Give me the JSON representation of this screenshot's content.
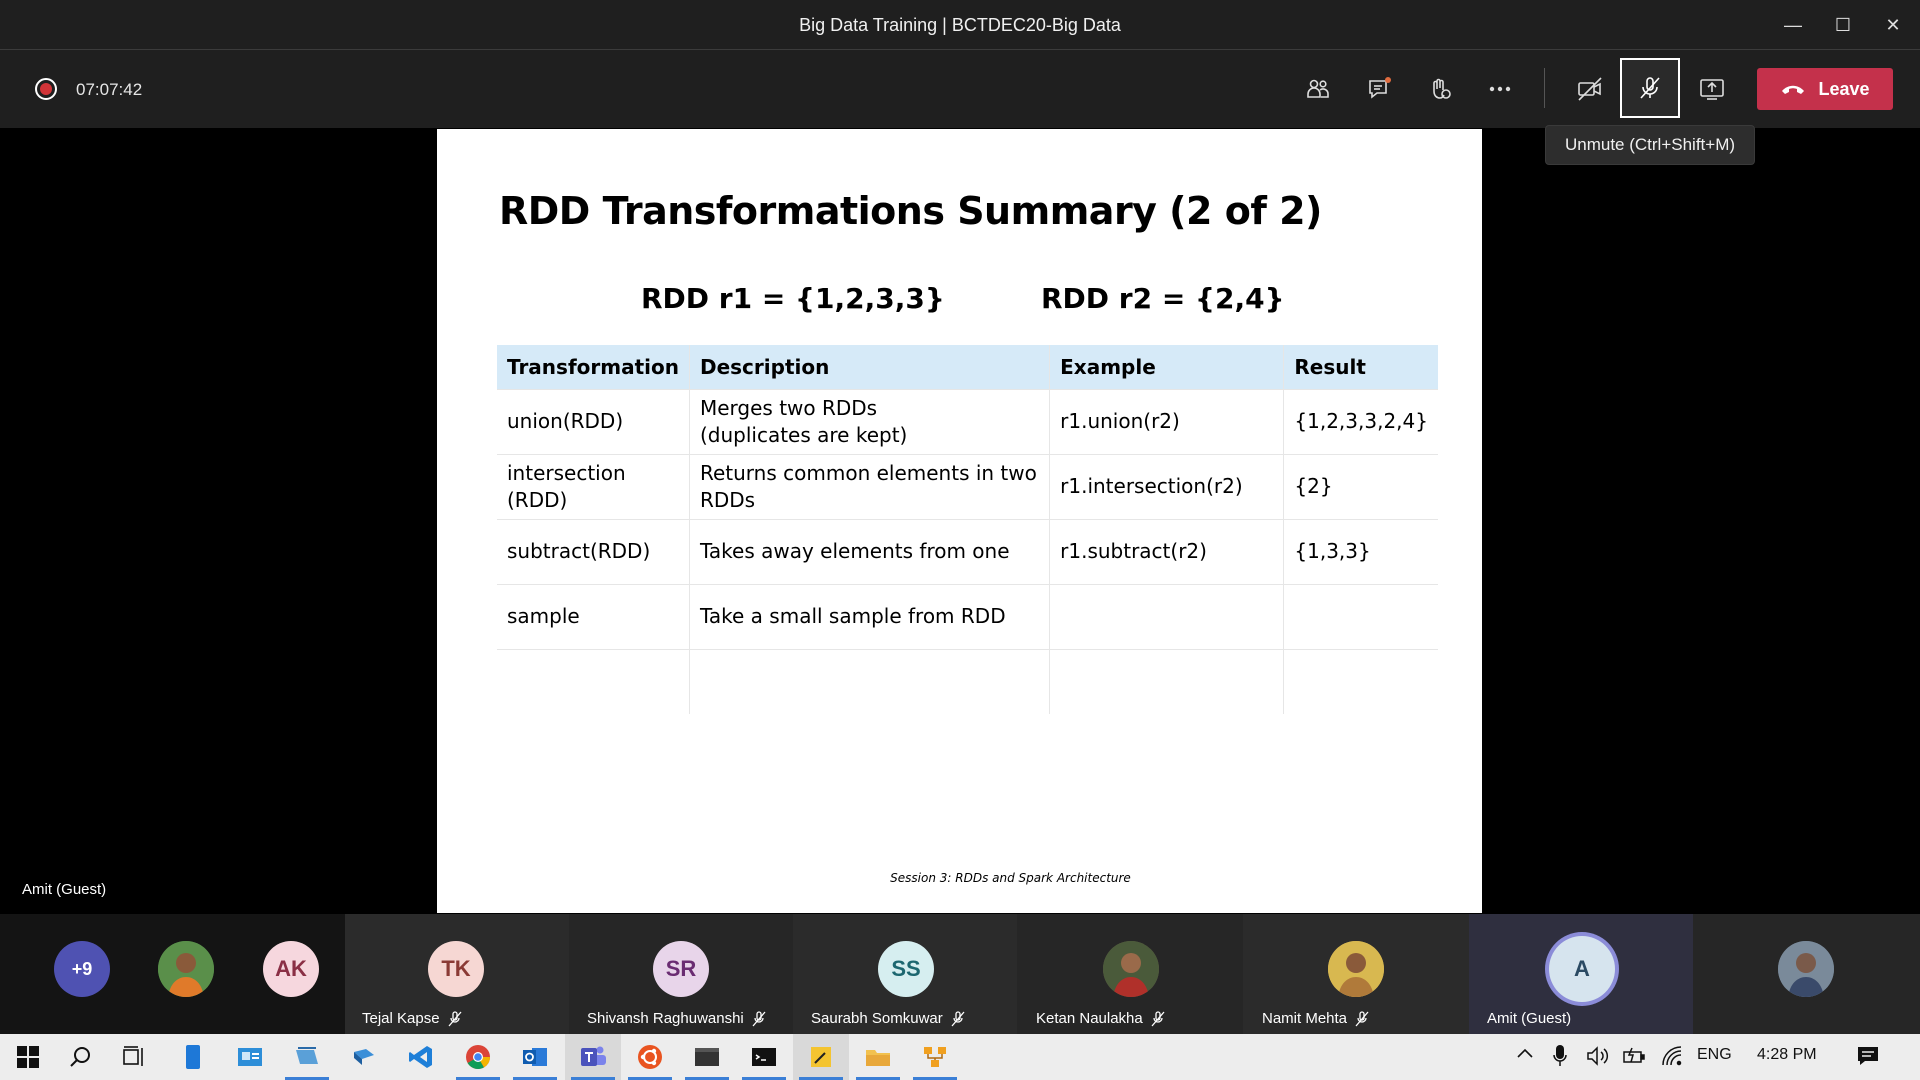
{
  "window": {
    "title": "Big Data Training | BCTDEC20-Big Data",
    "minimize": "—",
    "maximize": "☐",
    "close": "✕"
  },
  "toolbar": {
    "timer": "07:07:42",
    "leave_label": "Leave",
    "tooltip": "Unmute (Ctrl+Shift+M)"
  },
  "stage": {
    "presenter": "Amit (Guest)"
  },
  "slide": {
    "title": "RDD Transformations Summary (2 of 2)",
    "r1": "RDD r1 = {1,2,3,3}",
    "r2": "RDD r2 = {2,4}",
    "headers": [
      "Transformation",
      "Description",
      "Example",
      "Result"
    ],
    "rows": [
      {
        "transformation": "union(RDD)",
        "description_1": "Merges two RDDs",
        "description_2": "(duplicates are kept)",
        "example": "r1.union(r2)",
        "result": "{1,2,3,3,2,4}"
      },
      {
        "transformation_1": "intersection",
        "transformation_2": "(RDD)",
        "description_1": "Returns common elements in two",
        "description_2": "RDDs",
        "example": "r1.intersection(r2)",
        "result": "{2}"
      },
      {
        "transformation": "subtract(RDD)",
        "description": "Takes away elements from one",
        "example": "r1.subtract(r2)",
        "result": "{1,3,3}"
      },
      {
        "transformation": "sample",
        "description": "Take a small sample from RDD",
        "example": "",
        "result": ""
      }
    ],
    "footer": "Session 3: RDDs and Spark Architecture"
  },
  "participants": {
    "overflow": "+9",
    "ak_initials": "AK",
    "tiles": [
      {
        "initials": "TK",
        "name": "Tejal Kapse",
        "color": "#f6d7d3",
        "text_color": "#8a3a35"
      },
      {
        "initials": "SR",
        "name": "Shivansh Raghuwanshi",
        "color": "#e8d5ea",
        "text_color": "#6a2c72"
      },
      {
        "initials": "SS",
        "name": "Saurabh Somkuwar",
        "color": "#d6eef0",
        "text_color": "#1d6770"
      },
      {
        "initials": "",
        "name": "Ketan Naulakha",
        "color": "#6d5a4b",
        "text_color": "#fff"
      },
      {
        "initials": "",
        "name": "Namit Mehta",
        "color": "#c4a25a",
        "text_color": "#fff"
      },
      {
        "initials": "A",
        "name": "Amit (Guest)",
        "color": "#d6e4ee",
        "text_color": "#2b4a63"
      }
    ]
  },
  "taskbar": {
    "lang": "ENG",
    "time": "4:28 PM"
  },
  "colors": {
    "leave": "#c4314b",
    "recording": "#d13438",
    "table_header": "#d6eaf8",
    "overflow_badge": "#4f52b2"
  }
}
